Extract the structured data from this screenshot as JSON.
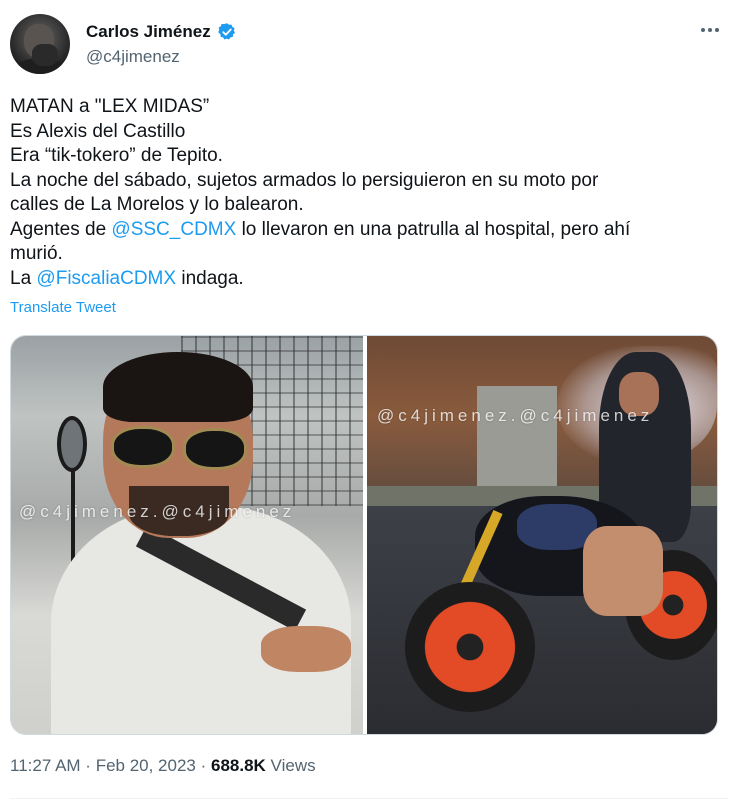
{
  "author": {
    "display_name": "Carlos Jiménez",
    "handle": "@c4jimenez",
    "verified_color": "#1d9bf0",
    "avatar_icon": "profile-photo"
  },
  "tweet": {
    "line1": "MATAN a \"LEX MIDAS”",
    "line2": "Es Alexis del Castillo",
    "line3": "Era “tik-tokero” de Tepito.",
    "line4": "La noche del sábado, sujetos armados lo persiguieron en su moto por",
    "line5": "calles de La Morelos y lo balearon.",
    "line6_before": "Agentes de ",
    "line6_mention": "@SSC_CDMX",
    "line6_after": " lo llevaron en una patrulla al hospital, pero ahí",
    "line7": "murió.",
    "line8_before": "La ",
    "line8_mention": "@FiscaliaCDMX",
    "line8_after": " indaga."
  },
  "translate_label": "Translate Tweet",
  "media": {
    "watermark_left": "@c4jimenez.@c4jimenez",
    "watermark_right": "@c4jimenez.@c4jimenez"
  },
  "meta": {
    "time": "11:27 AM",
    "separator": " · ",
    "date": "Feb 20, 2023",
    "separator2": " · ",
    "views_count": "688.8K",
    "views_label": " Views"
  },
  "colors": {
    "link": "#1d9bf0",
    "text": "#0f1419",
    "secondary": "#536471"
  }
}
